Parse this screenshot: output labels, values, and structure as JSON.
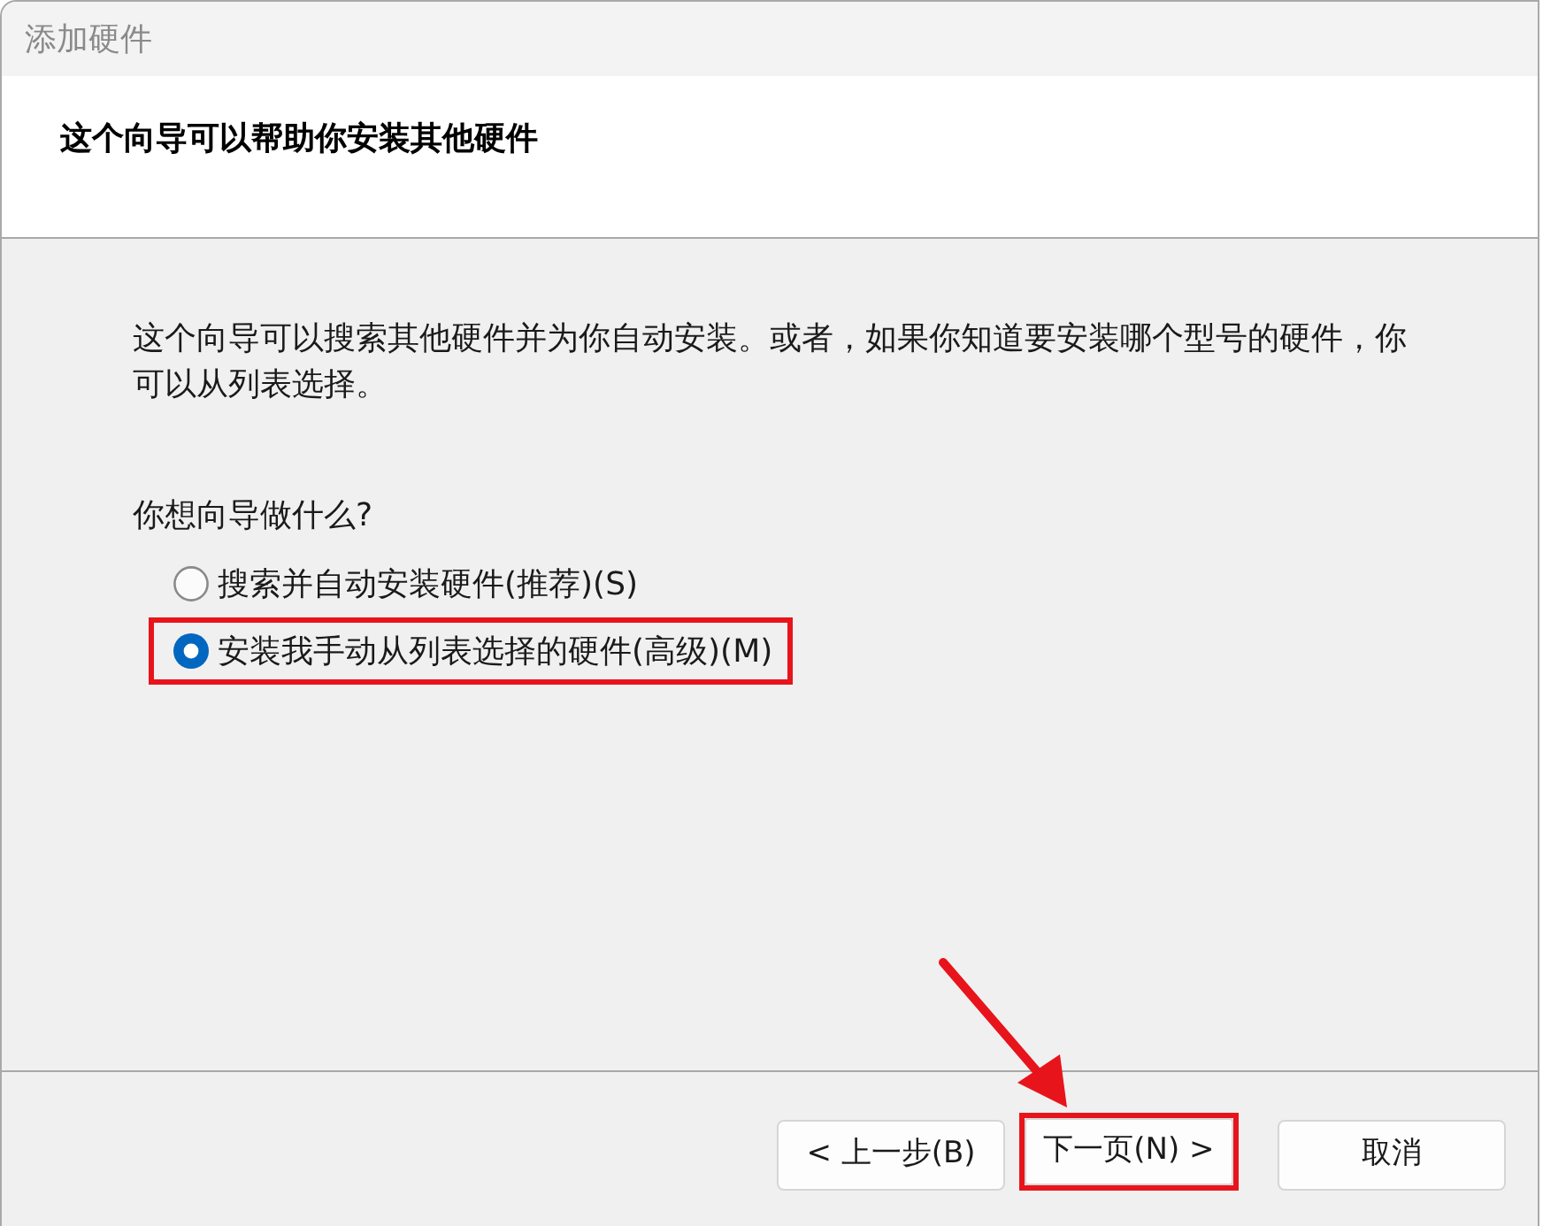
{
  "window": {
    "title": "添加硬件"
  },
  "header": {
    "heading": "这个向导可以帮助你安装其他硬件"
  },
  "body": {
    "intro": "这个向导可以搜索其他硬件并为你自动安装。或者，如果你知道要安装哪个型号的硬件，你可以从列表选择。",
    "question": "你想向导做什么?",
    "options": [
      {
        "label": "搜索并自动安装硬件(推荐)(S)",
        "selected": false,
        "highlighted": false
      },
      {
        "label": "安装我手动从列表选择的硬件(高级)(M)",
        "selected": true,
        "highlighted": true
      }
    ]
  },
  "buttons": [
    {
      "label": "< 上一步(B)",
      "kind": "nav",
      "highlighted": false,
      "arrow": false
    },
    {
      "label": "下一页(N) >",
      "kind": "nav",
      "highlighted": true,
      "arrow": true
    },
    {
      "label": "取消",
      "kind": "cancel",
      "highlighted": false,
      "arrow": false
    }
  ]
}
